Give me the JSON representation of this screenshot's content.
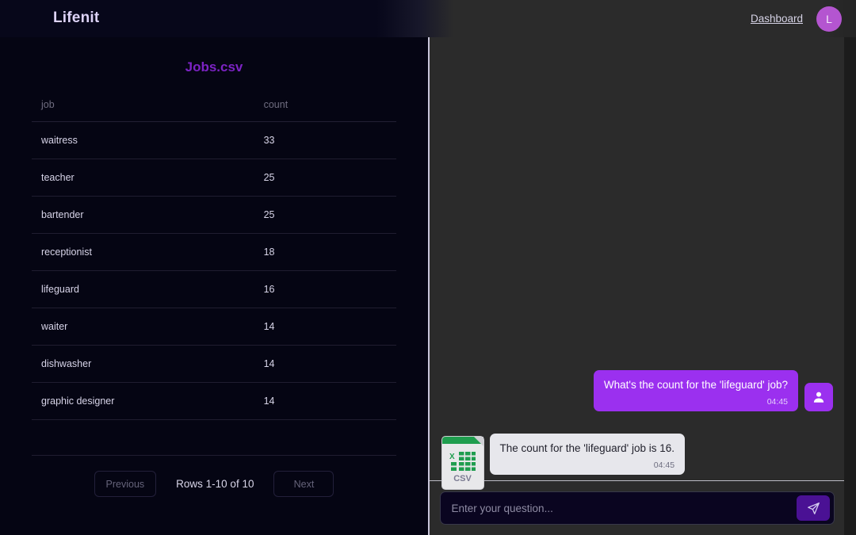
{
  "header": {
    "brand": "Lifenit",
    "nav_link": "Dashboard",
    "avatar_initial": "L",
    "avatar_color": "#b455d0"
  },
  "left_panel": {
    "file_title": "Jobs.csv",
    "file_title_color": "#7c23c4",
    "table": {
      "columns": [
        "job",
        "count"
      ],
      "rows": [
        {
          "job": "waitress",
          "count": "33"
        },
        {
          "job": "teacher",
          "count": "25"
        },
        {
          "job": "bartender",
          "count": "25"
        },
        {
          "job": "receptionist",
          "count": "18"
        },
        {
          "job": "lifeguard",
          "count": "16"
        },
        {
          "job": "waiter",
          "count": "14"
        },
        {
          "job": "dishwasher",
          "count": "14"
        },
        {
          "job": "graphic designer",
          "count": "14"
        },
        {
          "job": "",
          "count": ""
        }
      ]
    },
    "pagination": {
      "previous_label": "Previous",
      "next_label": "Next",
      "info": "Rows 1-10 of 10"
    }
  },
  "chat": {
    "messages": [
      {
        "role": "user",
        "text": "What's the count for the 'lifeguard' job?",
        "time": "04:45",
        "bubble_color": "#9b30ef",
        "avatar_icon": "person-icon"
      },
      {
        "role": "assistant",
        "text": "The count for the 'lifeguard' job is 16.",
        "time": "04:45",
        "bubble_color": "#e7e7ec",
        "avatar_icon": "csv-file-icon",
        "avatar_label": "CSV"
      }
    ],
    "composer": {
      "placeholder": "Enter your question...",
      "value": "",
      "send_icon": "send-paper-plane-icon",
      "send_color": "#4a1194"
    }
  }
}
